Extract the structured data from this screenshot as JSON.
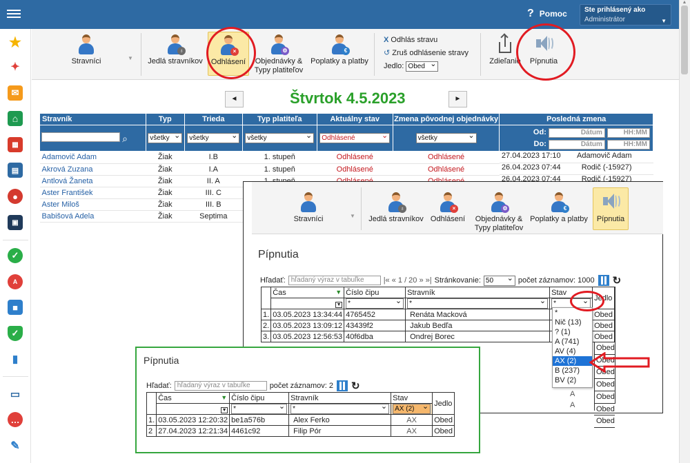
{
  "header": {
    "help_label": "Pomoc",
    "user_line1": "Ste prihlásený ako",
    "user_line2": "Administrátor"
  },
  "ribbon": {
    "stravnici": "Stravníci",
    "jedla": "Jedlá stravníkov",
    "odhlaseni": "Odhlásení",
    "objednavky_1": "Objednávky &",
    "objednavky_2": "Typy platiteľov",
    "poplatky": "Poplatky a platby",
    "odhlas": "Odhlás stravu",
    "zrus": "Zruš odhlásenie stravy",
    "jedlo_label": "Jedlo:",
    "jedlo_value": "Obed",
    "zdielanie": "Zdieľanie",
    "pipnutia": "Pípnutia"
  },
  "day": {
    "title": "Štvrtok 4.5.2023",
    "prev": "◄",
    "next": "►"
  },
  "main_table": {
    "headers": [
      "Stravník",
      "Typ",
      "Trieda",
      "Typ platiteľa",
      "Aktuálny stav",
      "Zmena pôvodnej objednávky",
      "Posledná zmena"
    ],
    "filter_all": "všetky",
    "filter_stav": "Odhlásené",
    "od": "Od:",
    "do": "Do:",
    "datum_ph": "Dátum",
    "time_ph": "HH:MM",
    "rows": [
      [
        "Adamovič Adam",
        "Žiak",
        "I.B",
        "1. stupeň",
        "Odhlásené",
        "Odhlásené",
        "27.04.2023 17:10",
        "Adamovič Adam"
      ],
      [
        "Akrová Zuzana",
        "Žiak",
        "I.A",
        "1. stupeň",
        "Odhlásené",
        "Odhlásené",
        "26.04.2023 07:44",
        "Rodič (-15927)"
      ],
      [
        "Antlová Žaneta",
        "Žiak",
        "II. A",
        "1. stupeň",
        "Odhlásené",
        "Odhlásené",
        "26.04.2023 07:44",
        "Rodič (-15927)"
      ],
      [
        "Aster František",
        "Žiak",
        "III. C",
        "",
        "",
        "",
        "",
        ""
      ],
      [
        "Aster Miloš",
        "Žiak",
        "III. B",
        "",
        "",
        "",
        "",
        ""
      ],
      [
        "Babišová Adela",
        "Žiak",
        "Septima",
        "",
        "",
        "",
        "",
        ""
      ]
    ]
  },
  "panel": {
    "title": "Pípnutia",
    "search_label": "Hľadať:",
    "search_ph": "hľadaný výraz v tabuľke",
    "pager": "|« « 1 / 20 » »|",
    "paging_label": "Stránkovanie:",
    "paging_value": "50",
    "count": "počet záznamov: 1000",
    "headers": [
      "Čas",
      "Číslo čipu",
      "Stravník",
      "Stav",
      "Jedlo"
    ],
    "filter": "*",
    "rows": [
      [
        "1.",
        "03.05.2023 13:34:44",
        "4765452",
        "Renáta Macková",
        "Obed"
      ],
      [
        "2.",
        "03.05.2023 13:09:12",
        "43439f2",
        "Jakub Bedľa",
        "Obed"
      ],
      [
        "3.",
        "03.05.2023 12:56:53",
        "40f6dba",
        "Ondrej Borec",
        "Obed"
      ]
    ],
    "extra_jedlo": [
      "Obed",
      "Obed",
      "Obed",
      "Obed",
      "Obed",
      "Obed",
      "Obed"
    ],
    "extra_stav": [
      "A",
      "A"
    ],
    "dropdown": [
      "*",
      "Nič (13)",
      "? (1)",
      "A (741)",
      "AV (4)",
      "AX (2)",
      "B (237)",
      "BV (2)"
    ]
  },
  "green": {
    "title": "Pípnutia",
    "search_label": "Hľadať:",
    "search_ph": "hľadaný výraz v tabuľke",
    "count": "počet záznamov: 2",
    "headers": [
      "Čas",
      "Číslo čipu",
      "Stravník",
      "Stav",
      "Jedlo"
    ],
    "filter": "*",
    "filter_stav": "AX (2)",
    "rows": [
      [
        "1.",
        "03.05.2023 12:20:32",
        "be1a576b",
        "Alex Ferko",
        "AX",
        "Obed"
      ],
      [
        "2",
        "27.04.2023 12:21:34",
        "4461c92",
        "Filip Pór",
        "AX",
        "Obed"
      ]
    ]
  },
  "colors": {
    "topbar": "#2e6aa3",
    "accent_red": "#e11b22",
    "accent_green": "#35a63e",
    "dropdown_selected": "#1e73d6"
  }
}
